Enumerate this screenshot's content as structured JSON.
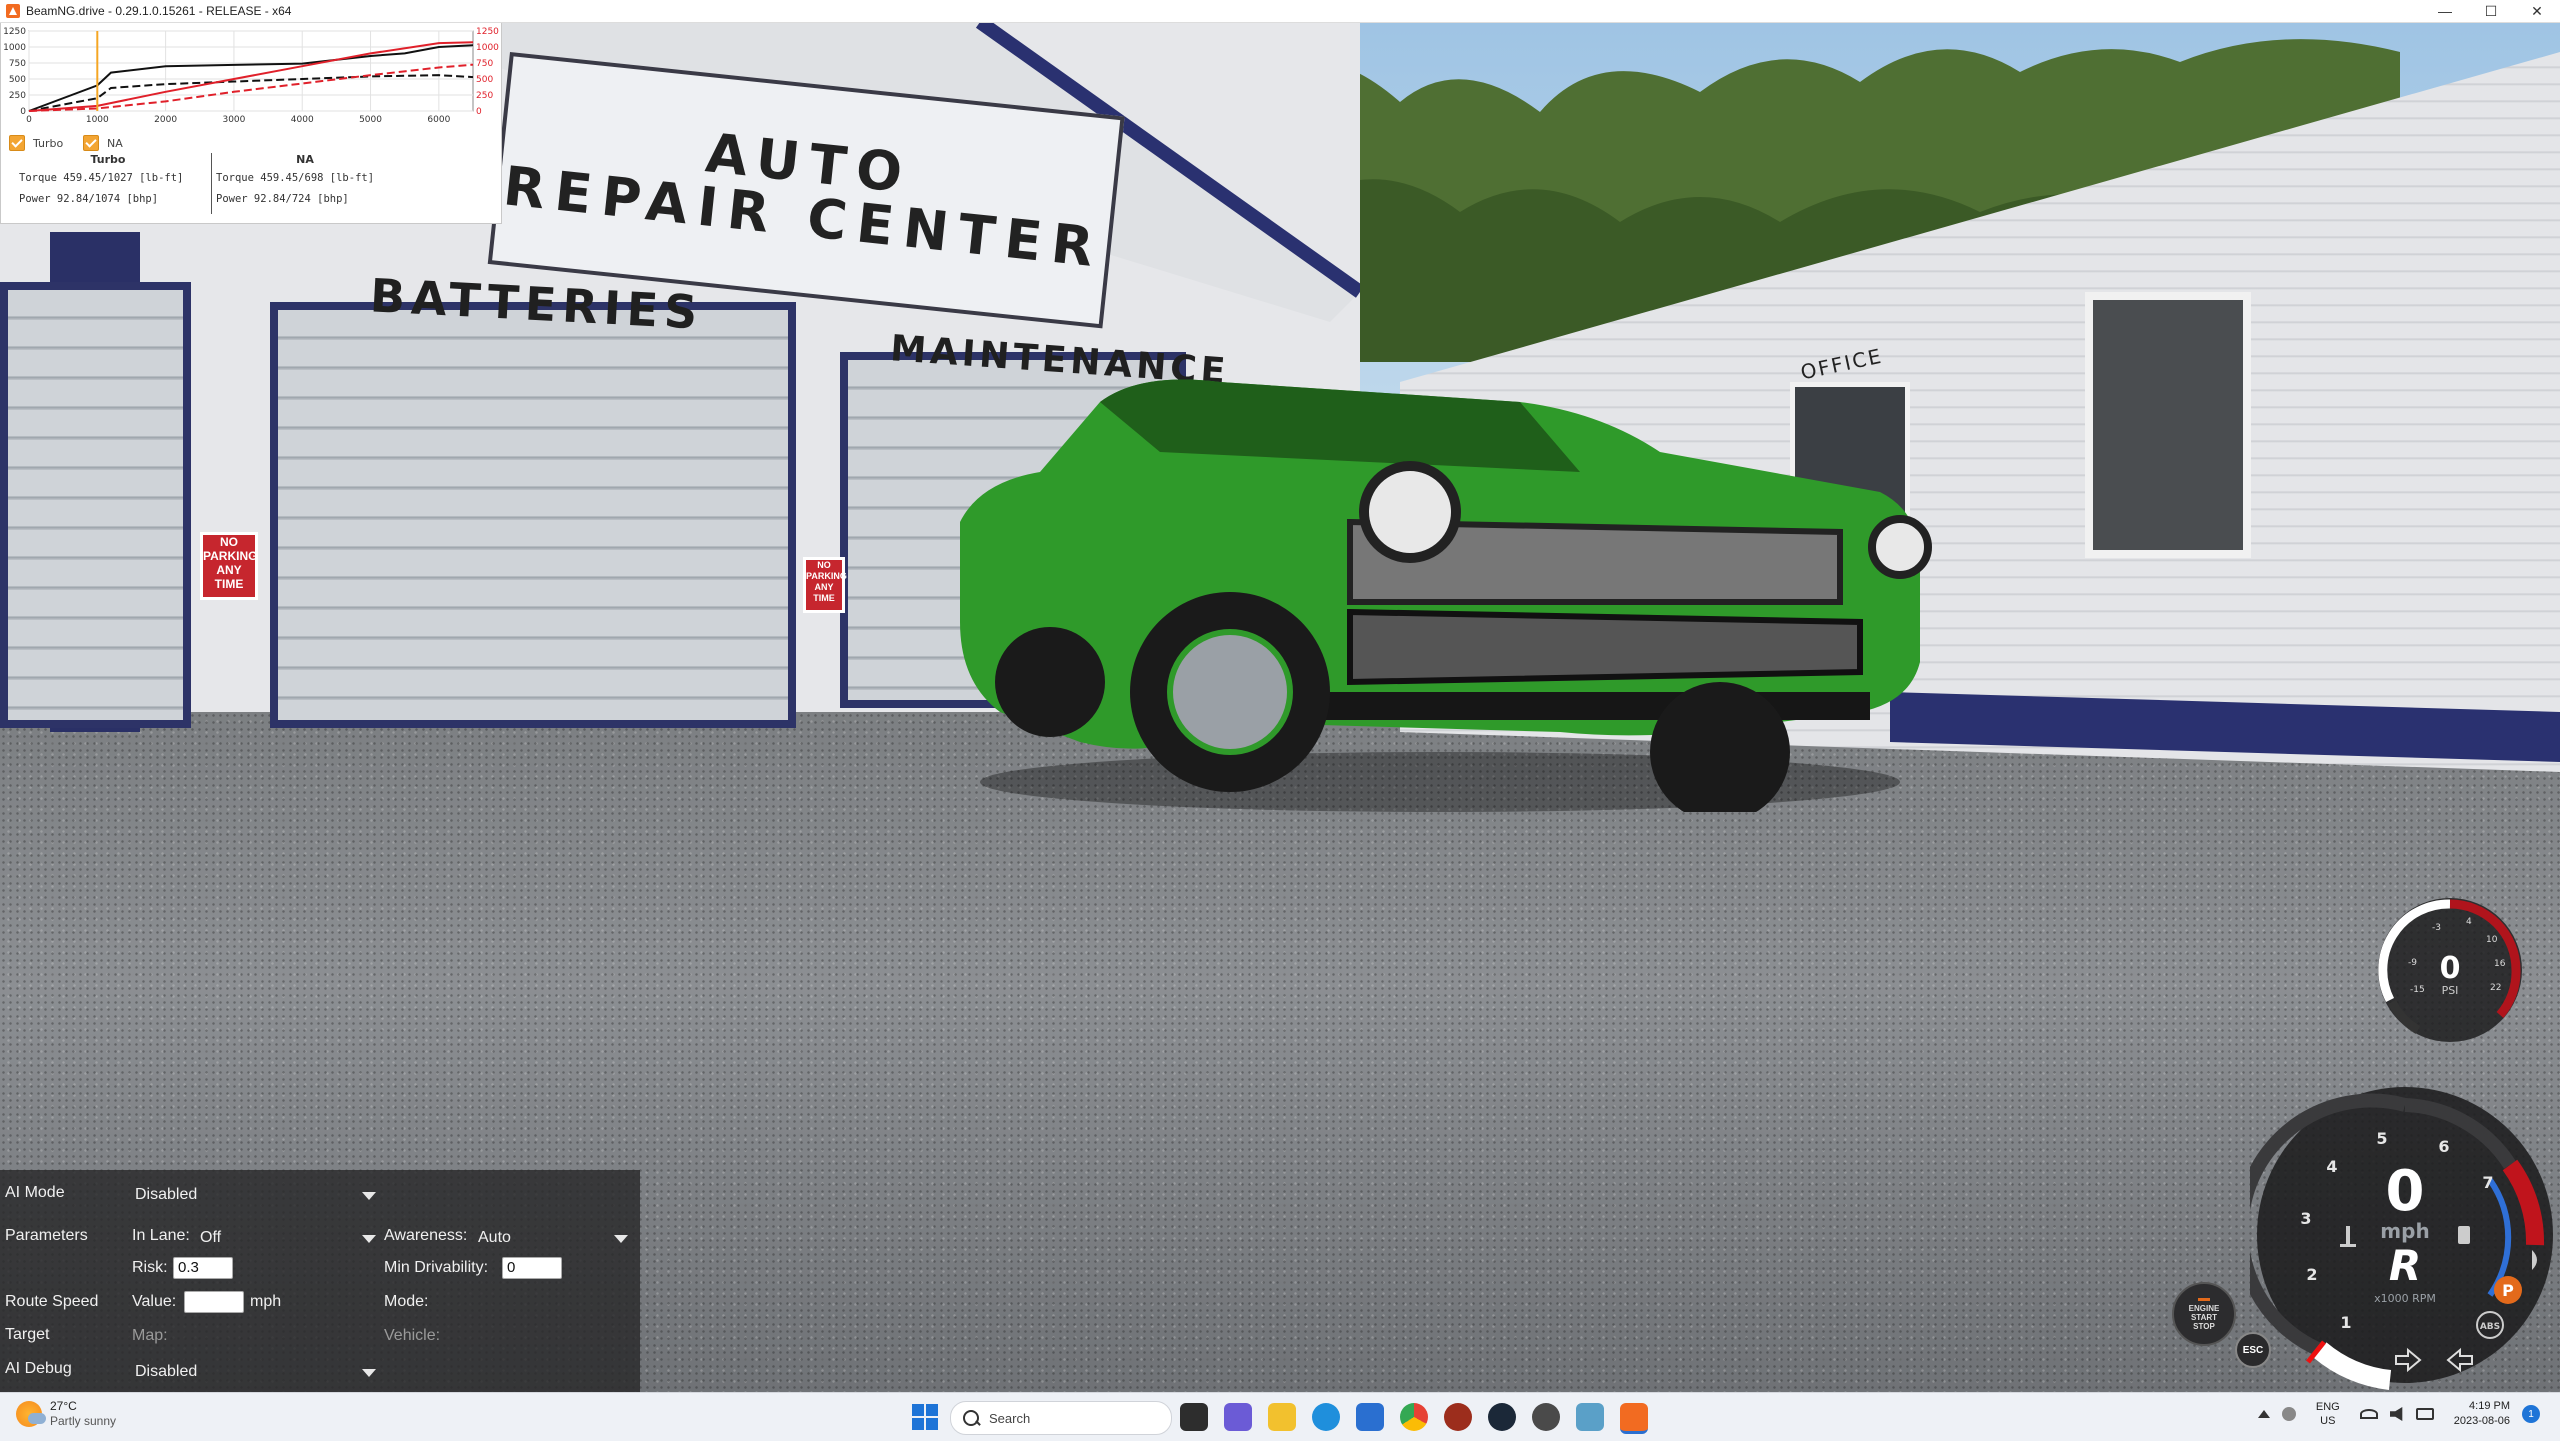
{
  "window": {
    "title": "BeamNG.drive - 0.29.1.0.15261 - RELEASE - x64",
    "controls": {
      "minimize": "—",
      "maximize": "☐",
      "close": "✕"
    }
  },
  "scene": {
    "sign_line1": "AUTO",
    "sign_line2": "REPAIR CENTER",
    "wall_sign_batteries": "BATTERIES",
    "wall_sign_maintenance": "MAINTENANCE",
    "wall_sign_office": "OFFICE",
    "no_parking_1": "NO PARKING ANY TIME",
    "no_parking_2": "NO PARKING ANY TIME"
  },
  "torque_graph": {
    "left_axis_ticks": [
      "1250",
      "1000",
      "750",
      "500",
      "250",
      "0"
    ],
    "right_axis_ticks": [
      "1250",
      "1000",
      "750",
      "500",
      "250",
      "0"
    ],
    "x_ticks": [
      "0",
      "1000",
      "2000",
      "3000",
      "4000",
      "5000",
      "6000"
    ],
    "checkbox_turbo": "Turbo",
    "checkbox_na": "NA",
    "turbo": {
      "heading": "Turbo",
      "torque": "Torque 459.45/1027 [lb-ft]",
      "power": "Power  92.84/1074  [bhp]"
    },
    "na": {
      "heading": "NA",
      "torque": "Torque 459.45/698 [lb-ft]",
      "power": "Power  92.84/724  [bhp]"
    },
    "colors": {
      "torque": "#111111",
      "power": "#e0202a",
      "rpm_marker": "#f5a623"
    }
  },
  "chart_data": {
    "type": "line",
    "x_range": [
      0,
      6500
    ],
    "ylim": [
      0,
      1250
    ],
    "series": [
      {
        "name": "Turbo",
        "x": [
          0,
          1000,
          1200,
          2000,
          3000,
          4000,
          5000,
          5500,
          6000,
          6500
        ],
        "y": [
          0,
          400,
          600,
          700,
          720,
          740,
          860,
          900,
          1000,
          1027
        ]
      },
      {
        "x": [
          0,
          1000,
          1200,
          2000,
          3000,
          4000,
          5000,
          6000,
          6500
        ],
        "y": [
          0,
          200,
          360,
          420,
          460,
          500,
          540,
          560,
          530
        ]
      },
      {
        "x": [
          0,
          1000,
          2000,
          3000,
          4000,
          5000,
          6000,
          6500
        ],
        "y": [
          0,
          80,
          300,
          500,
          700,
          900,
          1060,
          1074
        ]
      },
      {
        "x": [
          0,
          1000,
          2000,
          3000,
          4000,
          5000,
          6000,
          6500
        ],
        "y": [
          0,
          40,
          150,
          300,
          430,
          560,
          680,
          724
        ]
      }
    ]
  },
  "ai_panel": {
    "ai_mode_label": "AI Mode",
    "ai_mode_value": "Disabled",
    "parameters_label": "Parameters",
    "in_lane_label": "In Lane:",
    "in_lane_value": "Off",
    "awareness_label": "Awareness:",
    "awareness_value": "Auto",
    "risk_label": "Risk:",
    "risk_value": "0.3",
    "min_drivability_label": "Min Drivability:",
    "min_drivability_value": "0",
    "route_speed_label": "Route Speed",
    "value_label": "Value:",
    "value_value": "",
    "speed_unit": "mph",
    "mode_label": "Mode:",
    "target_label": "Target",
    "map_label": "Map:",
    "vehicle_label": "Vehicle:",
    "ai_debug_label": "AI Debug",
    "ai_debug_value": "Disabled"
  },
  "boost_gauge": {
    "value": "0",
    "unit": "PSI",
    "ticks": [
      "-3",
      "4",
      "10",
      "16",
      "22",
      "-15",
      "-9"
    ]
  },
  "speedometer": {
    "speed": "0",
    "unit": "mph",
    "gear": "R",
    "rpm_label": "x1000 RPM",
    "rpm_ticks": [
      "1",
      "2",
      "3",
      "4",
      "5",
      "6",
      "7"
    ],
    "rpm": 0,
    "parking_icon": "P",
    "abs_label": "ABS",
    "colors": {
      "redline": "#c0141c",
      "fuel": "#2f6fd6"
    }
  },
  "start_stop": {
    "line1": "ENGINE",
    "line2": "START",
    "line3": "STOP"
  },
  "esc_label": "ESC",
  "taskbar": {
    "weather_temp": "27°C",
    "weather_desc": "Partly sunny",
    "search_placeholder": "Search",
    "lang_top": "ENG",
    "lang_bottom": "US",
    "time": "4:19 PM",
    "date": "2023-08-06",
    "notification_count": "1"
  }
}
